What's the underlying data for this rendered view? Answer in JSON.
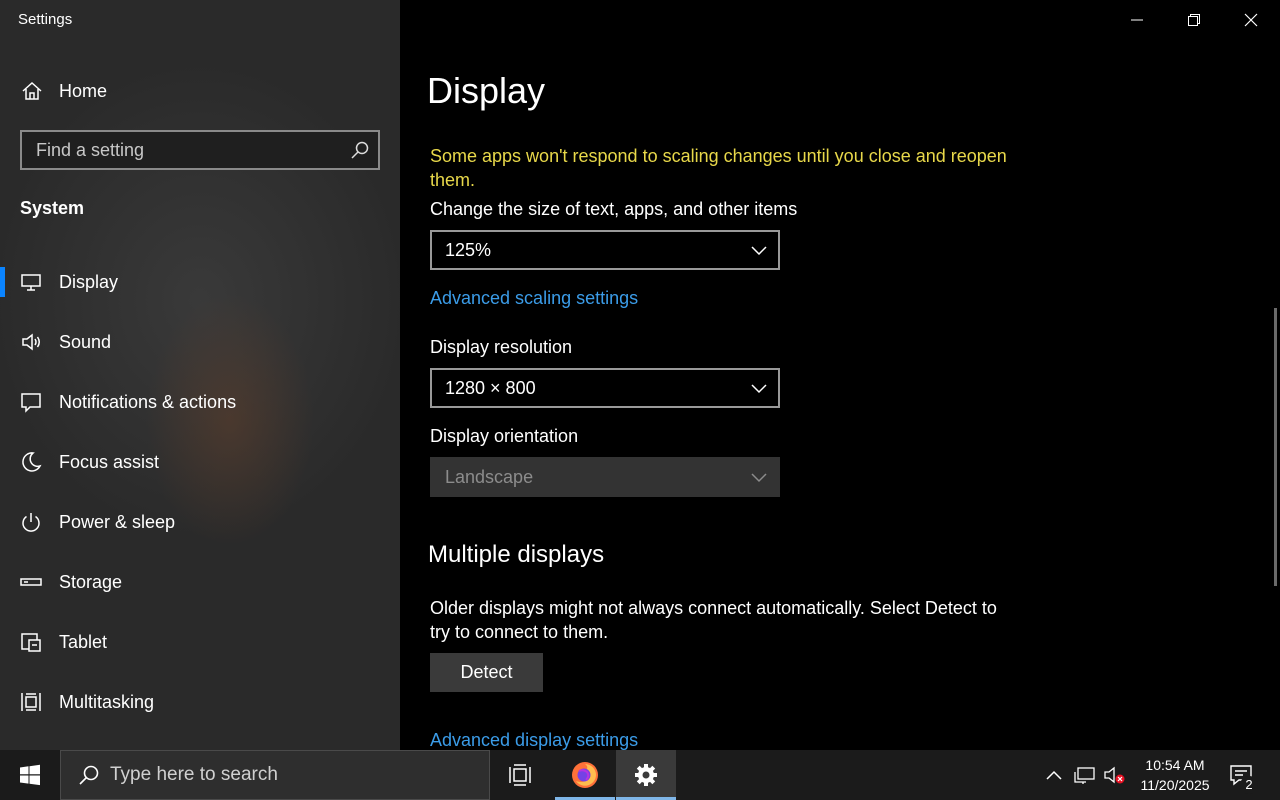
{
  "window": {
    "title": "Settings",
    "controls": {
      "minimize": "minimize-icon",
      "maximize": "restore-icon",
      "close": "close-icon"
    }
  },
  "sidebar": {
    "home_label": "Home",
    "search_placeholder": "Find a setting",
    "section_title": "System",
    "items": [
      {
        "label": "Display",
        "icon": "monitor-icon",
        "selected": true
      },
      {
        "label": "Sound",
        "icon": "speaker-icon"
      },
      {
        "label": "Notifications & actions",
        "icon": "message-icon"
      },
      {
        "label": "Focus assist",
        "icon": "moon-icon"
      },
      {
        "label": "Power & sleep",
        "icon": "power-icon"
      },
      {
        "label": "Storage",
        "icon": "drive-icon"
      },
      {
        "label": "Tablet",
        "icon": "tablet-icon"
      },
      {
        "label": "Multitasking",
        "icon": "multitasking-icon"
      }
    ]
  },
  "main": {
    "title": "Display",
    "warning": "Some apps won't respond to scaling changes until you close and reopen them.",
    "scale_label": "Change the size of text, apps, and other items",
    "scale_value": "125%",
    "advanced_scaling_link": "Advanced scaling settings",
    "resolution_label": "Display resolution",
    "resolution_value": "1280 × 800",
    "orientation_label": "Display orientation",
    "orientation_value": "Landscape",
    "multiple_displays_heading": "Multiple displays",
    "multiple_displays_text": "Older displays might not always connect automatically. Select Detect to try to connect to them.",
    "detect_button": "Detect",
    "advanced_display_link": "Advanced display settings"
  },
  "taskbar": {
    "search_placeholder": "Type here to search",
    "clock_time": "10:54 AM",
    "clock_date": "11/20/2025",
    "notification_count": "2",
    "pinned": [
      "task-view-icon",
      "firefox-icon",
      "settings-gear-icon"
    ]
  },
  "colors": {
    "accent": "#0a84ff",
    "link": "#3b9ce8",
    "warning": "#e8d84a"
  }
}
